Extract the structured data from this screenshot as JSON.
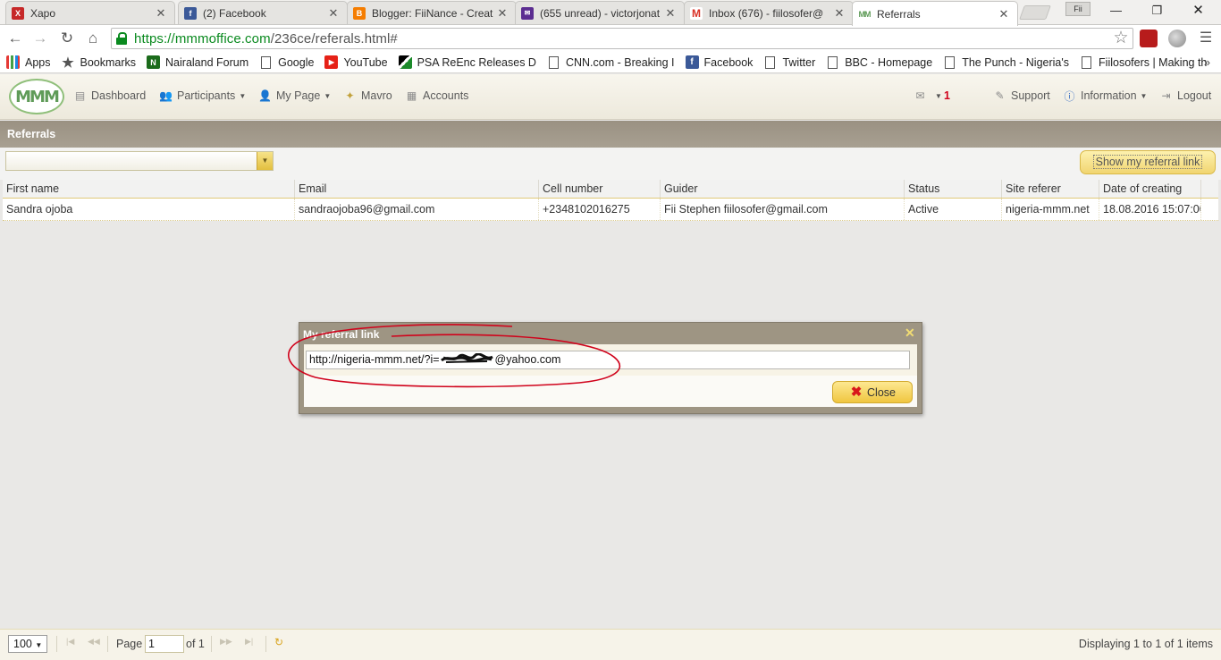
{
  "browser": {
    "tabs": [
      {
        "title": "Xapo",
        "favicon": "xapo-icon",
        "color": "#c62828",
        "glyph": "X"
      },
      {
        "title": "(2) Facebook",
        "favicon": "facebook-icon",
        "color": "#3b5998",
        "glyph": "f"
      },
      {
        "title": "Blogger: FiiNance - Creat",
        "favicon": "blogger-icon",
        "color": "#f57d00",
        "glyph": "B"
      },
      {
        "title": "(655 unread) - victorjonat",
        "favicon": "yahoo-mail-icon",
        "color": "#5c2d91",
        "glyph": "✉"
      },
      {
        "title": "Inbox (676) - fiilosofer@",
        "favicon": "gmail-icon",
        "color": "#d93025",
        "glyph": "M"
      },
      {
        "title": "Referrals",
        "favicon": "mmm-icon",
        "color": "#5f9b58",
        "glyph": "M"
      }
    ],
    "user_badge": "Fii",
    "url_scheme_host": "https://mmmoffice.com",
    "url_path": "/236ce/referals.html#",
    "bookmarks": [
      {
        "label": "Apps",
        "icon": "apps-grid-icon"
      },
      {
        "label": "Bookmarks",
        "icon": "star-icon"
      },
      {
        "label": "Nairaland Forum",
        "icon": "nairaland-icon"
      },
      {
        "label": "Google",
        "icon": "page-icon"
      },
      {
        "label": "YouTube",
        "icon": "youtube-icon"
      },
      {
        "label": "PSA ReEnc Releases D",
        "icon": "psa-icon"
      },
      {
        "label": "CNN.com - Breaking I",
        "icon": "page-icon"
      },
      {
        "label": "Facebook",
        "icon": "facebook-icon"
      },
      {
        "label": "Twitter",
        "icon": "page-icon"
      },
      {
        "label": "BBC - Homepage",
        "icon": "page-icon"
      },
      {
        "label": "The Punch - Nigeria's",
        "icon": "page-icon"
      },
      {
        "label": "Fiilosofers | Making th",
        "icon": "page-icon"
      }
    ],
    "bookmarks_more": "»"
  },
  "app": {
    "logo_text": "MMM",
    "menu": {
      "dashboard": "Dashboard",
      "participants": "Participants",
      "my_page": "My Page",
      "mavro": "Mavro",
      "accounts": "Accounts",
      "messages_count": "1",
      "support": "Support",
      "information": "Information",
      "logout": "Logout"
    }
  },
  "referrals": {
    "panel_title": "Referrals",
    "filter_value": "",
    "show_link_label": "Show my referral link",
    "columns": [
      "First name",
      "Email",
      "Cell number",
      "Guider",
      "Status",
      "Site referer",
      "Date of creating"
    ],
    "rows": [
      [
        "Sandra ojoba",
        "sandraojoba96@gmail.com",
        "+2348102016275",
        "Fii Stephen fiilosofer@gmail.com",
        "Active",
        "nigeria-mmm.net",
        "18.08.2016 15:07:00"
      ]
    ]
  },
  "pager": {
    "page_size": "100",
    "page_label": "Page",
    "page_value": "1",
    "of_label": "of 1",
    "display_text": "Displaying 1 to 1 of 1 items"
  },
  "dialog": {
    "title": "My referral link",
    "link_prefix": "http://nigeria-mmm.net/?i=",
    "link_suffix": "@yahoo.com",
    "close_label": "Close"
  },
  "colors": {
    "accent_gold": "#f0c640",
    "panel_header": "#9e9583",
    "annotation_red": "#d0021b",
    "secure_green": "#0a8a1f"
  }
}
